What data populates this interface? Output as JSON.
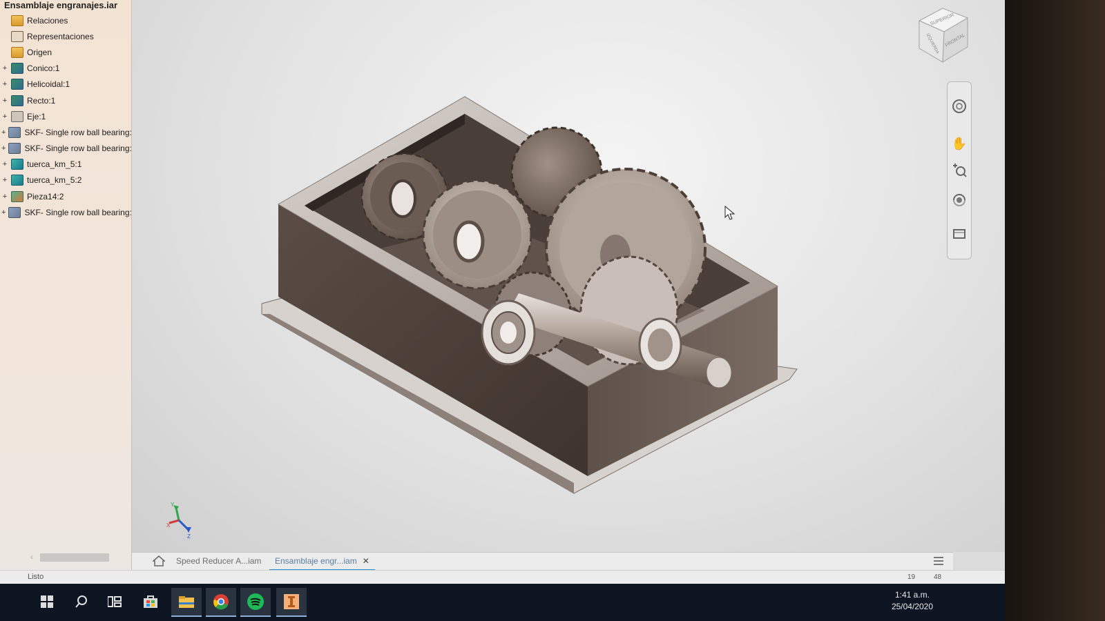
{
  "browser": {
    "title": "Ensamblaje engranajes.iar",
    "items": [
      {
        "label": "Relaciones",
        "expander": "",
        "icon": "folder"
      },
      {
        "label": "Representaciones",
        "expander": "",
        "icon": "representations"
      },
      {
        "label": "Origen",
        "expander": "",
        "icon": "folder"
      },
      {
        "label": "Conico:1",
        "expander": "+",
        "icon": "part"
      },
      {
        "label": "Helicoidal:1",
        "expander": "+",
        "icon": "part"
      },
      {
        "label": "Recto:1",
        "expander": "+",
        "icon": "part"
      },
      {
        "label": "Eje:1",
        "expander": "+",
        "icon": "frame"
      },
      {
        "label": "SKF- Single row ball bearing:",
        "expander": "+",
        "icon": "bearing"
      },
      {
        "label": "SKF- Single row ball bearing:",
        "expander": "+",
        "icon": "bearing"
      },
      {
        "label": "tuerca_km_5:1",
        "expander": "+",
        "icon": "nut"
      },
      {
        "label": "tuerca_km_5:2",
        "expander": "+",
        "icon": "nut"
      },
      {
        "label": "Pieza14:2",
        "expander": "+",
        "icon": "piece"
      },
      {
        "label": "SKF- Single row ball bearing:",
        "expander": "+",
        "icon": "bearing"
      }
    ]
  },
  "viewcube": {
    "top_face": "SUPERIOR",
    "left_face": "IZQUIERDA",
    "front_face": "FRONTAL"
  },
  "triad": {
    "x": "X",
    "y": "Y",
    "z": "Z"
  },
  "doc_tabs": [
    {
      "label": "Speed Reducer A...iam",
      "active": false
    },
    {
      "label": "Ensamblaje engr...iam",
      "active": true,
      "close": "✕"
    }
  ],
  "status": {
    "text": "Listo",
    "num1": "19",
    "num2": "48"
  },
  "taskbar": {
    "time": "1:41 a.m.",
    "date": "25/04/2020",
    "icons": [
      "windows-start-icon",
      "search-icon",
      "task-view-icon",
      "store-icon",
      "file-explorer-icon",
      "chrome-icon",
      "spotify-icon",
      "inventor-icon"
    ]
  },
  "colors": {
    "browser_bg": "#f3e3d3",
    "tab_accent": "#1f8fd0",
    "taskbar_bg": "#0d1522",
    "spotify": "#1db954"
  }
}
